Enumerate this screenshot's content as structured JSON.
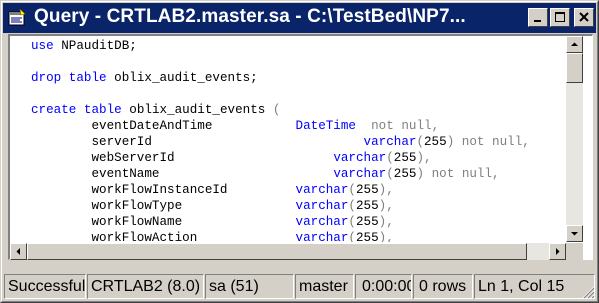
{
  "window": {
    "title": "Query - CRTLAB2.master.sa - C:\\TestBed\\NP7..."
  },
  "icons": {
    "app": "query-window-icon",
    "minimize": "minimize-icon",
    "maximize": "maximize-icon",
    "close": "close-icon",
    "scroll_up": "arrow-up-icon",
    "scroll_down": "arrow-down-icon",
    "scroll_left": "arrow-left-icon",
    "scroll_right": "arrow-right-icon",
    "grip": "size-grip-icon"
  },
  "colors": {
    "titlebar": "#0a246a",
    "keyword": "#0000ff",
    "comment_gray": "#808080",
    "face": "#d4d0c8"
  },
  "editor": {
    "lines": [
      {
        "tokens": [
          {
            "t": "use",
            "c": "kw"
          },
          {
            "t": " NPauditDB;",
            "c": ""
          }
        ]
      },
      {
        "tokens": []
      },
      {
        "tokens": [
          {
            "t": "drop",
            "c": "kw"
          },
          {
            "t": " ",
            "c": ""
          },
          {
            "t": "table",
            "c": "kw"
          },
          {
            "t": " oblix_audit_events;",
            "c": ""
          }
        ]
      },
      {
        "tokens": []
      },
      {
        "tokens": [
          {
            "t": "create",
            "c": "kw"
          },
          {
            "t": " ",
            "c": ""
          },
          {
            "t": "table",
            "c": "kw"
          },
          {
            "t": " oblix_audit_events ",
            "c": ""
          },
          {
            "t": "(",
            "c": "gr"
          }
        ]
      },
      {
        "tokens": [
          {
            "t": "        eventDateAndTime           ",
            "c": ""
          },
          {
            "t": "DateTime",
            "c": "kw"
          },
          {
            "t": "  ",
            "c": ""
          },
          {
            "t": "not null,",
            "c": "gr"
          }
        ]
      },
      {
        "tokens": [
          {
            "t": "        serverId                            ",
            "c": ""
          },
          {
            "t": "varchar",
            "c": "kw"
          },
          {
            "t": "(",
            "c": "gr"
          },
          {
            "t": "255",
            "c": ""
          },
          {
            "t": ") not null,",
            "c": "gr"
          }
        ]
      },
      {
        "tokens": [
          {
            "t": "        webServerId                     ",
            "c": ""
          },
          {
            "t": "varchar",
            "c": "kw"
          },
          {
            "t": "(",
            "c": "gr"
          },
          {
            "t": "255",
            "c": ""
          },
          {
            "t": "),",
            "c": "gr"
          }
        ]
      },
      {
        "tokens": [
          {
            "t": "        eventName                       ",
            "c": ""
          },
          {
            "t": "varchar",
            "c": "kw"
          },
          {
            "t": "(",
            "c": "gr"
          },
          {
            "t": "255",
            "c": ""
          },
          {
            "t": ") not null,",
            "c": "gr"
          }
        ]
      },
      {
        "tokens": [
          {
            "t": "        workFlowInstanceId         ",
            "c": ""
          },
          {
            "t": "varchar",
            "c": "kw"
          },
          {
            "t": "(",
            "c": "gr"
          },
          {
            "t": "255",
            "c": ""
          },
          {
            "t": "),",
            "c": "gr"
          }
        ]
      },
      {
        "tokens": [
          {
            "t": "        workFlowType               ",
            "c": ""
          },
          {
            "t": "varchar",
            "c": "kw"
          },
          {
            "t": "(",
            "c": "gr"
          },
          {
            "t": "255",
            "c": ""
          },
          {
            "t": "),",
            "c": "gr"
          }
        ]
      },
      {
        "tokens": [
          {
            "t": "        workFlowName               ",
            "c": ""
          },
          {
            "t": "varchar",
            "c": "kw"
          },
          {
            "t": "(",
            "c": "gr"
          },
          {
            "t": "255",
            "c": ""
          },
          {
            "t": "),",
            "c": "gr"
          }
        ]
      },
      {
        "tokens": [
          {
            "t": "        workFlowAction             ",
            "c": ""
          },
          {
            "t": "varchar",
            "c": "kw"
          },
          {
            "t": "(",
            "c": "gr"
          },
          {
            "t": "255",
            "c": ""
          },
          {
            "t": "),",
            "c": "gr"
          }
        ]
      }
    ]
  },
  "status": {
    "execution": "Successfull",
    "server": "CRTLAB2 (8.0)",
    "user": "sa (51)",
    "database": "master",
    "elapsed": "0:00:00",
    "rows": "0 rows",
    "position": "Ln 1, Col 15"
  }
}
